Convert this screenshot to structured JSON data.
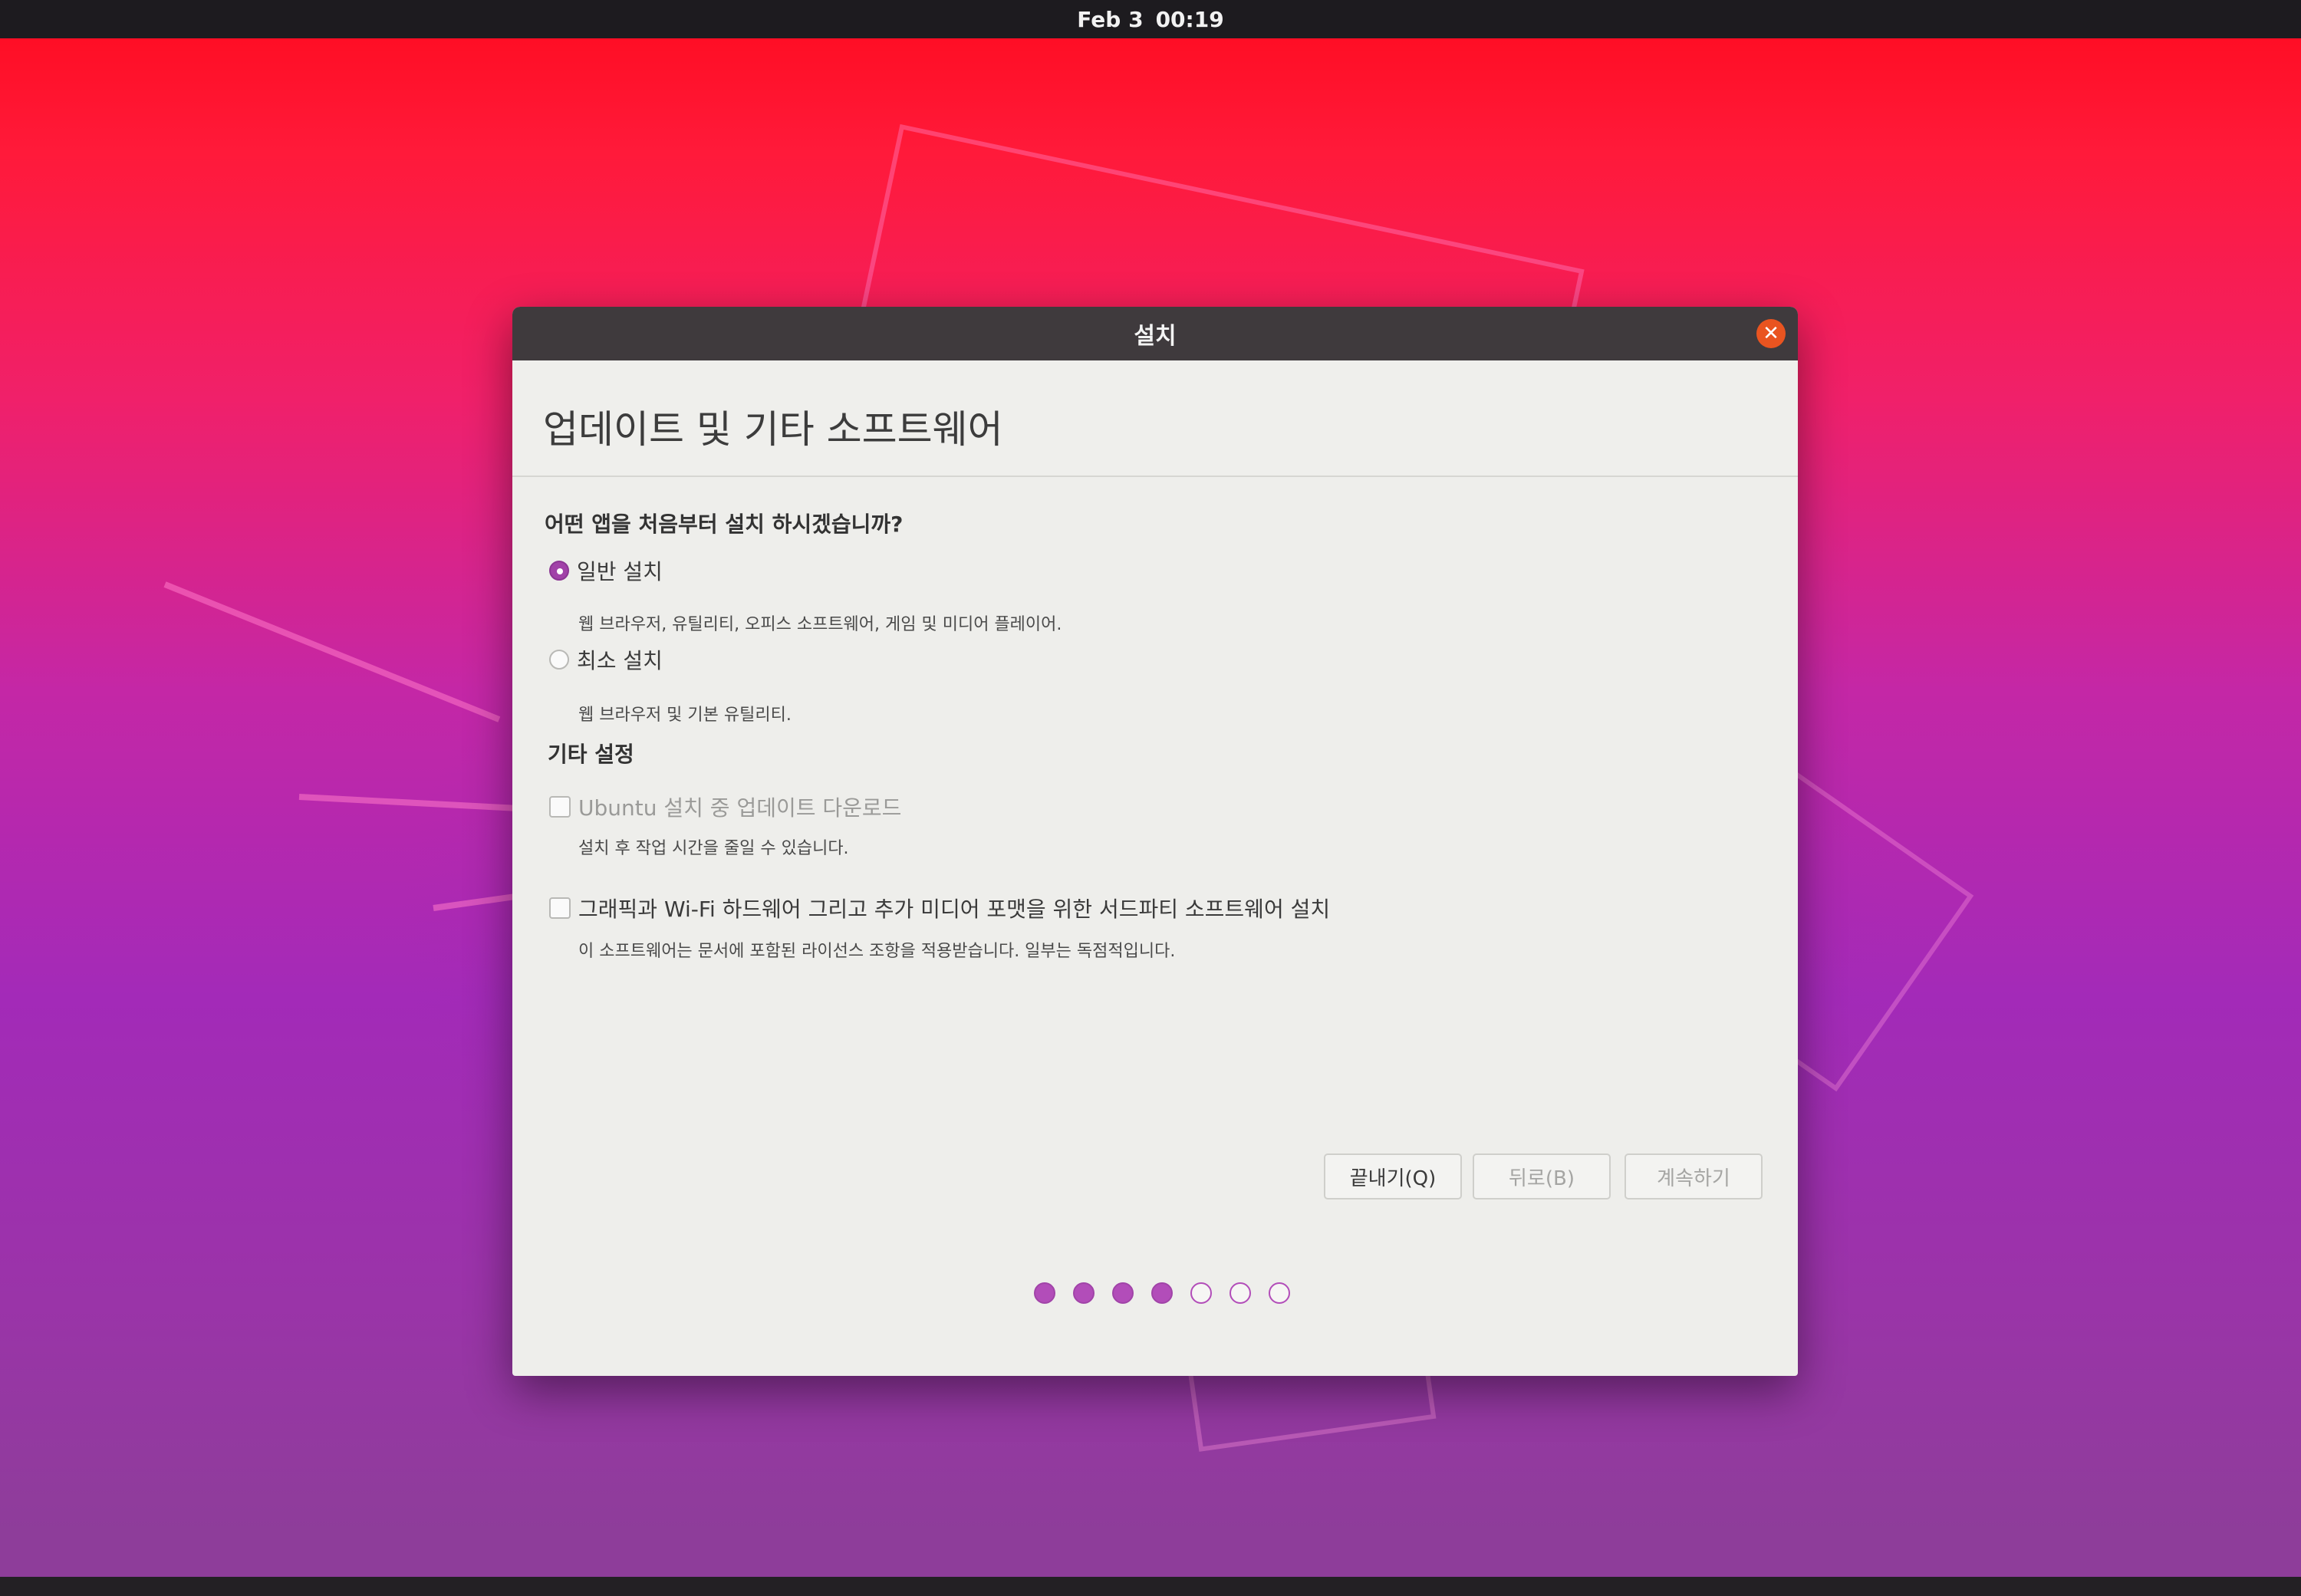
{
  "system": {
    "date": "Feb 3",
    "time": "00:19"
  },
  "window": {
    "title": "설치",
    "close_icon": "close-icon"
  },
  "page": {
    "title": "업데이트 및 기타 소프트웨어",
    "question": "어떤 앱을 처음부터 설치 하시겠습니까?",
    "install_options": [
      {
        "label": "일반 설치",
        "description": "웹 브라우저, 유틸리티, 오피스 소프트웨어, 게임 및 미디어 플레이어.",
        "selected": true
      },
      {
        "label": "최소 설치",
        "description": "웹 브라우저 및 기본 유틸리티.",
        "selected": false
      }
    ],
    "other_settings_title": "기타 설정",
    "other_options": [
      {
        "label": "Ubuntu 설치 중 업데이트 다운로드",
        "description": "설치 후 작업 시간을 줄일 수 있습니다.",
        "checked": false,
        "enabled": false
      },
      {
        "label": "그래픽과 Wi-Fi 하드웨어 그리고 추가 미디어 포맷을 위한 서드파티 소프트웨어 설치",
        "description": "이 소프트웨어는 문서에 포함된 라이선스 조항을 적용받습니다. 일부는 독점적입니다.",
        "checked": false,
        "enabled": true
      }
    ]
  },
  "buttons": {
    "quit": "끝내기(Q)",
    "back": "뒤로(B)",
    "continue": "계속하기"
  },
  "progress": {
    "completed_steps": 4,
    "total_steps": 7
  },
  "colors": {
    "accent": "#b24db9",
    "close": "#e95420",
    "titlebar": "#3f3a3d"
  }
}
